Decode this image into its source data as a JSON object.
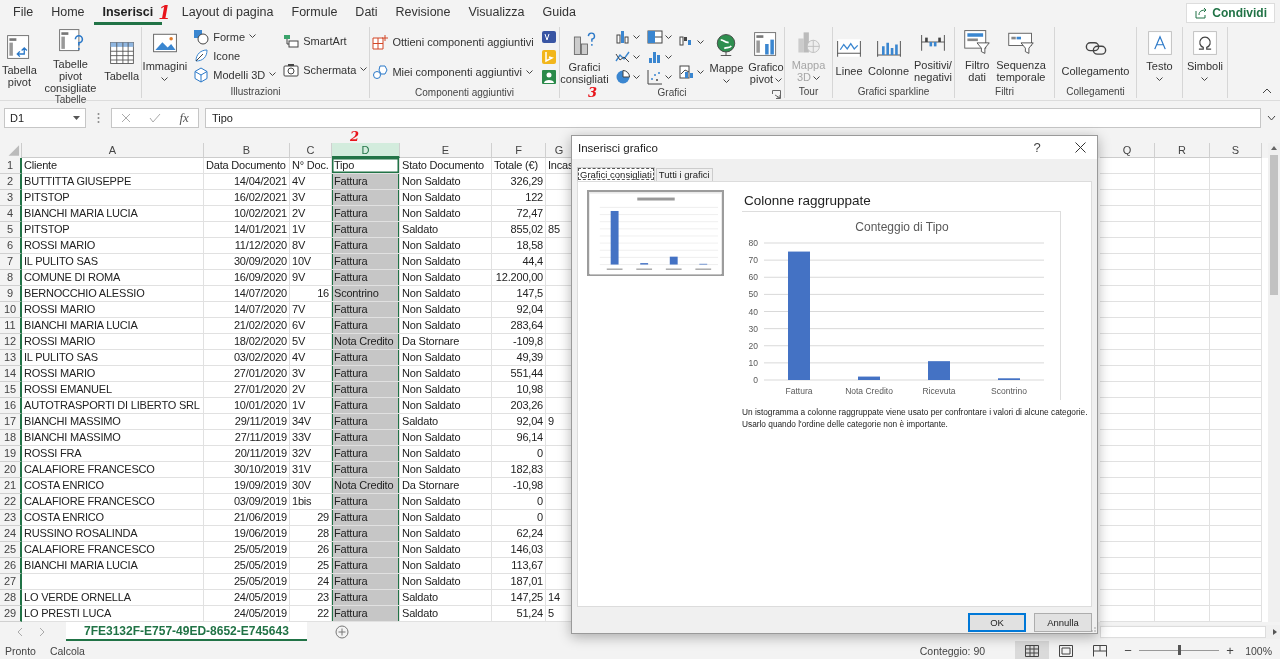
{
  "menu_tabs": [
    {
      "label": "File",
      "selected": false
    },
    {
      "label": "Home",
      "selected": false
    },
    {
      "label": "Inserisci",
      "selected": true
    },
    {
      "label": "Layout di pagina",
      "selected": false
    },
    {
      "label": "Formule",
      "selected": false
    },
    {
      "label": "Dati",
      "selected": false
    },
    {
      "label": "Revisione",
      "selected": false
    },
    {
      "label": "Visualizza",
      "selected": false
    },
    {
      "label": "Guida",
      "selected": false
    }
  ],
  "share_button": "Condividi",
  "ribbon_groups": [
    {
      "label": "Tabelle",
      "columns": [
        [
          {
            "kind": "large",
            "label": "Tabella\npivot",
            "dropdown": false,
            "disabled": false
          }
        ],
        [
          {
            "kind": "large",
            "label": "Tabelle pivot\nconsigliate",
            "dropdown": false,
            "disabled": false
          }
        ],
        [
          {
            "kind": "large",
            "label": "Tabella",
            "dropdown": false,
            "disabled": false
          }
        ]
      ]
    },
    {
      "label": "Illustrazioni",
      "columns": [
        [
          {
            "kind": "large",
            "label": "Immagini",
            "dropdown": true,
            "disabled": false
          }
        ],
        [
          {
            "kind": "small",
            "label": "Forme",
            "dropdown": true,
            "disabled": false
          },
          {
            "kind": "small",
            "label": "Icone",
            "dropdown": false,
            "disabled": false
          },
          {
            "kind": "small",
            "label": "Modelli 3D",
            "dropdown": true,
            "disabled": false
          }
        ],
        [
          {
            "kind": "small",
            "label": "SmartArt",
            "dropdown": false,
            "disabled": false
          },
          {
            "kind": "small",
            "label": "Schermata",
            "dropdown": true,
            "disabled": false
          }
        ]
      ]
    },
    {
      "label": "Componenti aggiuntivi",
      "columns": [
        [
          {
            "kind": "small",
            "label": "Ottieni componenti aggiuntivi",
            "dropdown": false,
            "disabled": false
          },
          {
            "kind": "small",
            "label": "Miei componenti aggiuntivi",
            "dropdown": true,
            "disabled": false
          }
        ],
        [
          {
            "kind": "icon",
            "dropdown": false,
            "disabled": false
          },
          {
            "kind": "icon",
            "dropdown": false,
            "disabled": false
          },
          {
            "kind": "icon",
            "dropdown": false,
            "disabled": false
          }
        ]
      ]
    },
    {
      "label": "Grafici",
      "launcher": true,
      "columns": [
        [
          {
            "kind": "large",
            "label": "Grafici\nconsigliati",
            "dropdown": false,
            "disabled": false
          }
        ],
        [
          {
            "kind": "icon",
            "dropdown": true,
            "disabled": false
          },
          {
            "kind": "icon",
            "dropdown": true,
            "disabled": false
          },
          {
            "kind": "icon",
            "dropdown": true,
            "disabled": false
          }
        ],
        [
          {
            "kind": "icon",
            "dropdown": true,
            "disabled": false
          },
          {
            "kind": "icon",
            "dropdown": true,
            "disabled": false
          },
          {
            "kind": "icon",
            "dropdown": true,
            "disabled": false
          }
        ],
        [
          {
            "kind": "icon",
            "dropdown": true,
            "disabled": false
          },
          {
            "kind": "icon",
            "dropdown": true,
            "disabled": false
          }
        ],
        [
          {
            "kind": "large",
            "label": "Mappe",
            "dropdown": true,
            "disabled": false
          }
        ],
        [
          {
            "kind": "large",
            "label": "Grafico\npivot",
            "dropdown": true,
            "disabled": false
          }
        ]
      ]
    },
    {
      "label": "Tour",
      "columns": [
        [
          {
            "kind": "large",
            "label": "Mappa\n3D",
            "dropdown": true,
            "disabled": true
          }
        ]
      ]
    },
    {
      "label": "Grafici sparkline",
      "columns": [
        [
          {
            "kind": "large",
            "label": "Linee",
            "dropdown": false,
            "disabled": false
          }
        ],
        [
          {
            "kind": "large",
            "label": "Colonne",
            "dropdown": false,
            "disabled": false
          }
        ],
        [
          {
            "kind": "large",
            "label": "Positivi/\nnegativi",
            "dropdown": false,
            "disabled": false
          }
        ]
      ]
    },
    {
      "label": "Filtri",
      "columns": [
        [
          {
            "kind": "large",
            "label": "Filtro\ndati",
            "dropdown": false,
            "disabled": false
          }
        ],
        [
          {
            "kind": "large",
            "label": "Sequenza\ntemporale",
            "dropdown": false,
            "disabled": false
          }
        ]
      ]
    },
    {
      "label": "Collegamenti",
      "columns": [
        [
          {
            "kind": "large",
            "label": "Collegamento",
            "dropdown": false,
            "disabled": false
          }
        ]
      ]
    },
    {
      "columns": [
        [
          {
            "kind": "large",
            "label": "Testo",
            "dropdown": true,
            "disabled": false
          }
        ]
      ]
    },
    {
      "columns": [
        [
          {
            "kind": "large",
            "label": "Simboli",
            "dropdown": true,
            "disabled": false
          }
        ]
      ]
    }
  ],
  "formula_bar": {
    "name_box": "D1",
    "function_label": "fx",
    "value": "Tipo"
  },
  "sheet": {
    "columns": [
      {
        "letter": "A",
        "selected": false
      },
      {
        "letter": "B",
        "selected": false
      },
      {
        "letter": "C",
        "selected": false
      },
      {
        "letter": "D",
        "selected": true
      },
      {
        "letter": "E",
        "selected": false
      },
      {
        "letter": "F",
        "selected": false
      },
      {
        "letter": "G",
        "selected": false
      },
      {
        "letter": "Q",
        "selected": false
      },
      {
        "letter": "R",
        "selected": false
      },
      {
        "letter": "S",
        "selected": false
      }
    ],
    "rows": [
      {
        "n": "1",
        "kind": "header",
        "cells": [
          "Cliente",
          "Data Documento",
          "N° Doc.",
          "Tipo",
          "Stato Documento",
          "Totale (€)",
          "Incas"
        ]
      },
      {
        "n": "2",
        "kind": "data",
        "doc_numeric": false,
        "cells": [
          "BUTTITTA GIUSEPPE",
          "14/04/2021",
          "4V",
          "Fattura",
          "Non Saldato",
          "326,29",
          null
        ]
      },
      {
        "n": "3",
        "kind": "data",
        "doc_numeric": false,
        "cells": [
          "PITSTOP",
          "16/02/2021",
          "3V",
          "Fattura",
          "Non Saldato",
          "122",
          null
        ]
      },
      {
        "n": "4",
        "kind": "data",
        "doc_numeric": false,
        "cells": [
          "BIANCHI MARIA LUCIA",
          "10/02/2021",
          "2V",
          "Fattura",
          "Non Saldato",
          "72,47",
          null
        ]
      },
      {
        "n": "5",
        "kind": "data",
        "doc_numeric": false,
        "cells": [
          "PITSTOP",
          "14/01/2021",
          "1V",
          "Fattura",
          "Saldato",
          "855,02",
          "85"
        ]
      },
      {
        "n": "6",
        "kind": "data",
        "doc_numeric": false,
        "cells": [
          "ROSSI MARIO",
          "11/12/2020",
          "8V",
          "Fattura",
          "Non Saldato",
          "18,58",
          null
        ]
      },
      {
        "n": "7",
        "kind": "data",
        "doc_numeric": false,
        "cells": [
          "IL PULITO SAS",
          "30/09/2020",
          "10V",
          "Fattura",
          "Non Saldato",
          "44,4",
          null
        ]
      },
      {
        "n": "8",
        "kind": "data",
        "doc_numeric": false,
        "cells": [
          "COMUNE DI ROMA",
          "16/09/2020",
          "9V",
          "Fattura",
          "Non Saldato",
          "12.200,00",
          null
        ]
      },
      {
        "n": "9",
        "kind": "data",
        "doc_numeric": true,
        "cells": [
          "BERNOCCHIO ALESSIO",
          "14/07/2020",
          "16",
          "Scontrino",
          "Non Saldato",
          "147,5",
          null
        ]
      },
      {
        "n": "10",
        "kind": "data",
        "doc_numeric": false,
        "cells": [
          "ROSSI MARIO",
          "14/07/2020",
          "7V",
          "Fattura",
          "Non Saldato",
          "92,04",
          null
        ]
      },
      {
        "n": "11",
        "kind": "data",
        "doc_numeric": false,
        "cells": [
          "BIANCHI MARIA LUCIA",
          "21/02/2020",
          "6V",
          "Fattura",
          "Non Saldato",
          "283,64",
          null
        ]
      },
      {
        "n": "12",
        "kind": "data",
        "doc_numeric": false,
        "cells": [
          "ROSSI MARIO",
          "18/02/2020",
          "5V",
          "Nota Credito",
          "Da Stornare",
          "-109,8",
          null
        ]
      },
      {
        "n": "13",
        "kind": "data",
        "doc_numeric": false,
        "cells": [
          "IL PULITO SAS",
          "03/02/2020",
          "4V",
          "Fattura",
          "Non Saldato",
          "49,39",
          null
        ]
      },
      {
        "n": "14",
        "kind": "data",
        "doc_numeric": false,
        "cells": [
          "ROSSI MARIO",
          "27/01/2020",
          "3V",
          "Fattura",
          "Non Saldato",
          "551,44",
          null
        ]
      },
      {
        "n": "15",
        "kind": "data",
        "doc_numeric": false,
        "cells": [
          "ROSSI EMANUEL",
          "27/01/2020",
          "2V",
          "Fattura",
          "Non Saldato",
          "10,98",
          null
        ]
      },
      {
        "n": "16",
        "kind": "data",
        "doc_numeric": false,
        "cells": [
          "AUTOTRASPORTI DI LIBERTO SRL",
          "10/01/2020",
          "1V",
          "Fattura",
          "Non Saldato",
          "203,26",
          null
        ]
      },
      {
        "n": "17",
        "kind": "data",
        "doc_numeric": false,
        "cells": [
          "BIANCHI MASSIMO",
          "29/11/2019",
          "34V",
          "Fattura",
          "Saldato",
          "92,04",
          "9"
        ]
      },
      {
        "n": "18",
        "kind": "data",
        "doc_numeric": false,
        "cells": [
          "BIANCHI MASSIMO",
          "27/11/2019",
          "33V",
          "Fattura",
          "Non Saldato",
          "96,14",
          null
        ]
      },
      {
        "n": "19",
        "kind": "data",
        "doc_numeric": false,
        "cells": [
          "ROSSI FRA",
          "20/11/2019",
          "32V",
          "Fattura",
          "Non Saldato",
          "0",
          null
        ]
      },
      {
        "n": "20",
        "kind": "data",
        "doc_numeric": false,
        "cells": [
          "CALAFIORE FRANCESCO",
          "30/10/2019",
          "31V",
          "Fattura",
          "Non Saldato",
          "182,83",
          null
        ]
      },
      {
        "n": "21",
        "kind": "data",
        "doc_numeric": false,
        "cells": [
          "COSTA ENRICO",
          "19/09/2019",
          "30V",
          "Nota Credito",
          "Da Stornare",
          "-10,98",
          null
        ]
      },
      {
        "n": "22",
        "kind": "data",
        "doc_numeric": false,
        "cells": [
          "CALAFIORE FRANCESCO",
          "03/09/2019",
          "1bis",
          "Fattura",
          "Non Saldato",
          "0",
          null
        ]
      },
      {
        "n": "23",
        "kind": "data",
        "doc_numeric": true,
        "cells": [
          "COSTA ENRICO",
          "21/06/2019",
          "29",
          "Fattura",
          "Non Saldato",
          "0",
          null
        ]
      },
      {
        "n": "24",
        "kind": "data",
        "doc_numeric": true,
        "cells": [
          "RUSSINO ROSALINDA",
          "19/06/2019",
          "28",
          "Fattura",
          "Non Saldato",
          "62,24",
          null
        ]
      },
      {
        "n": "25",
        "kind": "data",
        "doc_numeric": true,
        "cells": [
          "CALAFIORE FRANCESCO",
          "25/05/2019",
          "26",
          "Fattura",
          "Non Saldato",
          "146,03",
          null
        ]
      },
      {
        "n": "26",
        "kind": "data",
        "doc_numeric": true,
        "cells": [
          "BIANCHI MARIA LUCIA",
          "25/05/2019",
          "25",
          "Fattura",
          "Non Saldato",
          "113,67",
          null
        ]
      },
      {
        "n": "27",
        "kind": "data",
        "doc_numeric": true,
        "cells": [
          null,
          "25/05/2019",
          "24",
          "Fattura",
          "Non Saldato",
          "187,01",
          null
        ]
      },
      {
        "n": "28",
        "kind": "data",
        "doc_numeric": true,
        "cells": [
          "LO VERDE ORNELLA",
          "24/05/2019",
          "23",
          "Fattura",
          "Saldato",
          "147,25",
          "14"
        ]
      },
      {
        "n": "29",
        "kind": "data",
        "doc_numeric": true,
        "cells": [
          "LO PRESTI LUCA",
          "24/05/2019",
          "22",
          "Fattura",
          "Saldato",
          "51,24",
          "5"
        ]
      }
    ]
  },
  "sheet_tabs": [
    {
      "label": "7FE3132F-E757-49ED-8652-E745643",
      "selected": true
    }
  ],
  "status_bar": {
    "left": [
      "Pronto",
      "Calcola"
    ],
    "count": "Conteggio: 90",
    "view_buttons": [
      {
        "selected": true
      },
      {
        "selected": false
      },
      {
        "selected": false
      }
    ],
    "zoom": {
      "minus": "−",
      "plus": "+",
      "level": 0.5,
      "reading": "100%"
    }
  },
  "dialog": {
    "title": "Inserisci grafico",
    "help": "?",
    "tabs": [
      {
        "label": "Grafici consigliati",
        "selected": true
      },
      {
        "label": "Tutti i grafici",
        "selected": false
      }
    ],
    "thumbnails": [
      {
        "selected": true
      }
    ],
    "chart_name": "Colonne raggruppate",
    "chart_data": {
      "type": "bar",
      "title": "Conteggio di Tipo",
      "categories": [
        "Fattura",
        "Nota Credito",
        "Ricevuta",
        "Scontrino"
      ],
      "grid": true,
      "series": [
        {
          "color": "#4472c4",
          "values": [
            75,
            2,
            11,
            1
          ]
        }
      ],
      "ylim": [
        0,
        80
      ],
      "yticks": [
        0,
        10,
        20,
        30,
        40,
        50,
        60,
        70,
        80
      ]
    },
    "description": "Un istogramma a colonne raggruppate viene usato per confrontare i valori di alcune categorie. Usarlo quando l'ordine delle categorie non è importante.",
    "buttons": [
      {
        "label": "OK",
        "kind": "default"
      },
      {
        "label": "Annulla",
        "kind": "normal"
      }
    ]
  },
  "annotations": [
    "1",
    "2",
    "3"
  ]
}
